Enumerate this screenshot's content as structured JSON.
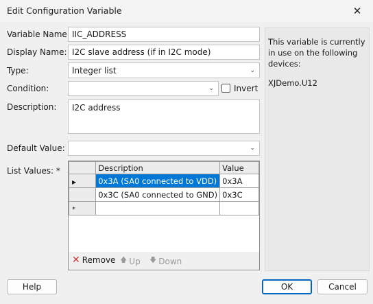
{
  "window": {
    "title": "Edit Configuration Variable"
  },
  "form": {
    "variable_name_label": "Variable Name: *",
    "variable_name_value": "IIC_ADDRESS",
    "display_name_label": "Display Name: *",
    "display_name_value": "I2C slave address (if in I2C mode)",
    "type_label": "Type:",
    "type_value": "Integer list",
    "condition_label": "Condition:",
    "condition_value": "",
    "invert_label": "Invert",
    "invert_checked": false,
    "description_label": "Description:",
    "description_value": "I2C address",
    "default_value_label": "Default Value:",
    "default_value_value": "",
    "list_values_label": "List Values: *"
  },
  "list_table": {
    "headers": [
      "Description",
      "Value"
    ],
    "rows": [
      {
        "indicator": "▶",
        "description": "0x3A (SA0 connected to VDD)",
        "value": "0x3A",
        "selected": true
      },
      {
        "indicator": "",
        "description": "0x3C (SA0 connected to GND)",
        "value": "0x3C",
        "selected": false
      },
      {
        "indicator": "*",
        "description": "",
        "value": "",
        "selected": false
      }
    ]
  },
  "toolbar": {
    "remove": "Remove",
    "up": "Up",
    "down": "Down"
  },
  "info_panel": {
    "text": "This variable is currently in use on the following devices:",
    "devices": [
      "XJDemo.U12"
    ]
  },
  "buttons": {
    "help": "Help",
    "ok": "OK",
    "cancel": "Cancel"
  },
  "colors": {
    "selection": "#0078d7",
    "remove_icon": "#d13438",
    "disabled_text": "#9a9a9a"
  },
  "icons": {
    "close": "close-icon",
    "dropdown": "chevron-down-icon",
    "remove": "x-icon",
    "up": "arrow-up-icon",
    "down": "arrow-down-icon",
    "row_pointer": "row-pointer-icon",
    "new_row": "new-row-icon"
  }
}
